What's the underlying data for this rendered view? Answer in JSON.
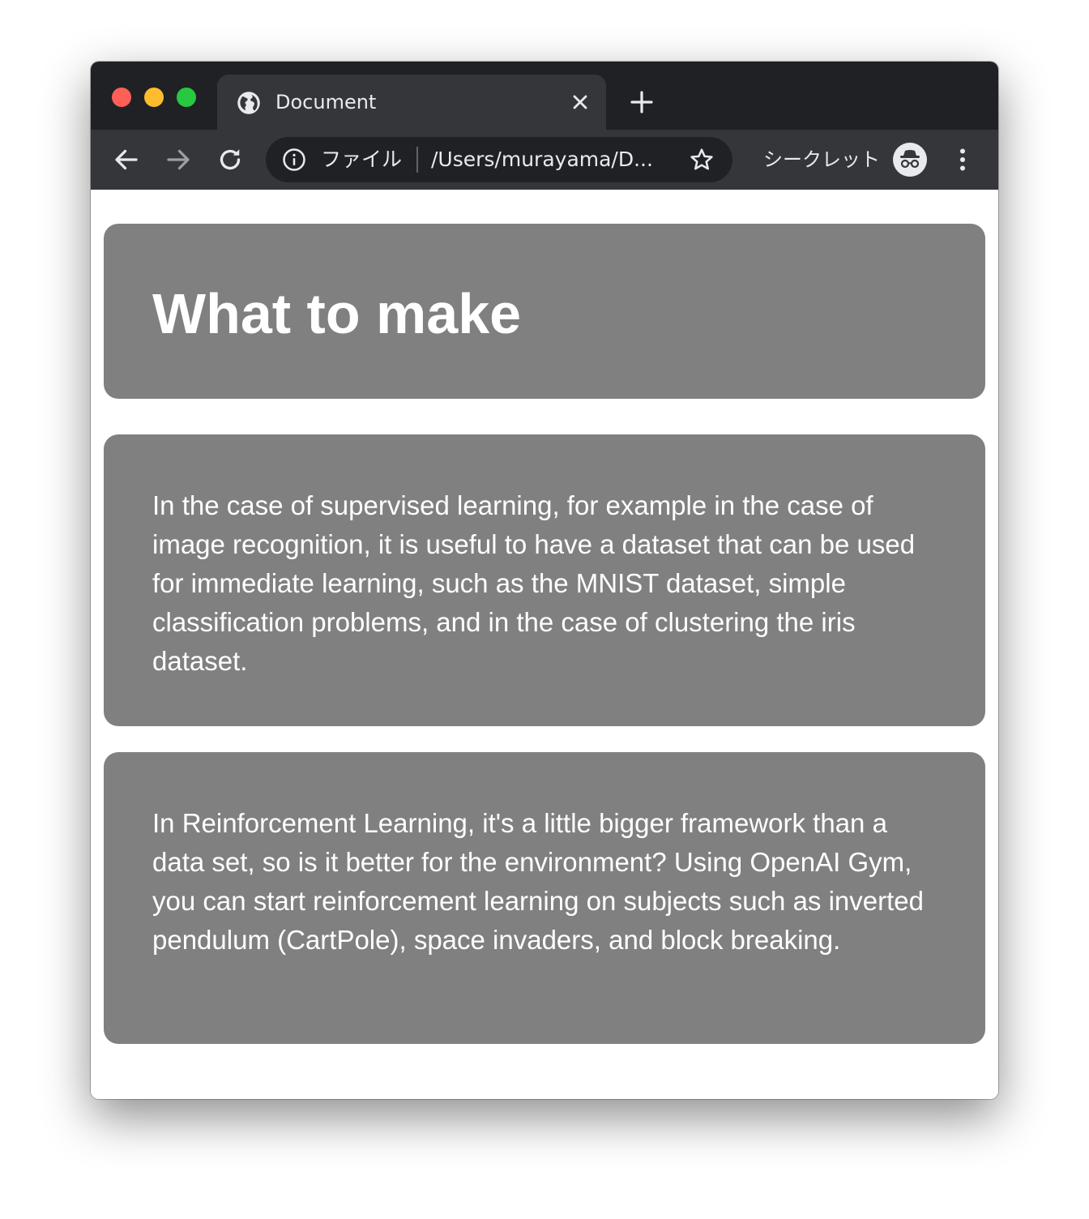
{
  "browser": {
    "tab": {
      "title": "Document"
    },
    "omnibox": {
      "scheme_label": "ファイル",
      "url": "/Users/murayama/D..."
    },
    "incognito_label": "シークレット",
    "colors": {
      "tabbar": "#202124",
      "toolbar": "#35363a",
      "omnibox": "#202124",
      "traffic_close": "#fe5f57",
      "traffic_minimize": "#febc2e",
      "traffic_maximize": "#28c840"
    },
    "icons": [
      "globe-icon",
      "close-icon",
      "plus-icon",
      "back-arrow-icon",
      "forward-arrow-icon",
      "reload-icon",
      "info-icon",
      "star-icon",
      "incognito-icon",
      "kebab-menu-icon"
    ]
  },
  "page": {
    "heading": "What to make",
    "paragraphs": [
      "In the case of supervised learning, for example in the case of image recognition, it is useful to have a dataset that can be used for immediate learning, such as the MNIST dataset, simple classification problems, and in the case of clustering the iris dataset.",
      "In Reinforcement Learning, it's a little bigger framework than a data set, so is it better for the environment? Using OpenAI Gym, you can start reinforcement learning on subjects such as inverted pendulum (CartPole), space invaders, and block breaking."
    ],
    "colors": {
      "card_background": "#808080",
      "card_text": "#ffffff",
      "page_background": "#ffffff"
    }
  }
}
